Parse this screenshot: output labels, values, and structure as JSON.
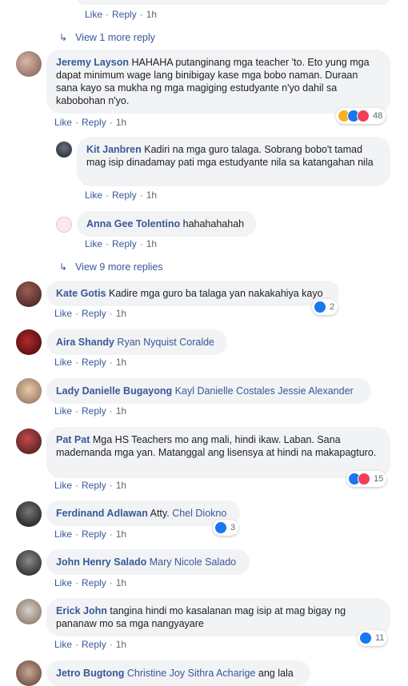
{
  "actions": {
    "like": "Like",
    "reply": "Reply"
  },
  "top_reply": {
    "time": "1h"
  },
  "view_more_1": "View 1 more reply",
  "c1": {
    "author": "Jeremy Layson",
    "text": "HAHAHA putanginang mga teacher 'to. Eto yung mga dapat minimum wage lang binibigay kase mga bobo naman. Duraan sana kayo sa mukha ng mga magiging estudyante n'yo dahil sa kabobohan n'yo.",
    "time": "1h",
    "reactions": "48"
  },
  "r1": {
    "author": "Kit Janbren",
    "text": "Kadiri na mga guro talaga. Sobrang bobo't tamad mag isip dinadamay pati mga estudyante nila sa katangahan nila",
    "time": "1h"
  },
  "r2": {
    "author": "Anna Gee Tolentino",
    "text": "hahahahahah",
    "time": "1h"
  },
  "view_more_9": "View 9 more replies",
  "c2": {
    "author": "Kate Gotis",
    "text": "Kadire mga guro ba talaga yan nakakahiya kayo",
    "time": "1h",
    "reactions": "2"
  },
  "c3": {
    "author": "Aira Shandy",
    "tag": "Ryan Nyquist Coralde",
    "time": "1h"
  },
  "c4": {
    "author": "Lady Danielle Bugayong",
    "tag": "Kayl Danielle Costales Jessie Alexander",
    "time": "1h"
  },
  "c5": {
    "author": "Pat Pat",
    "text": "Mga HS Teachers mo ang mali, hindi ikaw. Laban. Sana mademanda mga yan. Matanggal ang lisensya at hindi na makapagturo.",
    "time": "1h",
    "reactions": "15"
  },
  "c6": {
    "author": "Ferdinand Adlawan",
    "text": "Atty.",
    "tag": "Chel Diokno",
    "time": "1h",
    "reactions": "3"
  },
  "c7": {
    "author": "John Henry Salado",
    "tag": "Mary Nicole Salado",
    "time": "1h"
  },
  "c8": {
    "author": "Erick John",
    "text": "tangina hindi mo kasalanan mag isip at mag bigay ng pananaw mo sa mga nangyayare",
    "time": "1h",
    "reactions": "11"
  },
  "c9": {
    "author": "Jetro Bugtong",
    "tag": "Christine Joy Sithra Acharige",
    "text": "ang lala"
  }
}
